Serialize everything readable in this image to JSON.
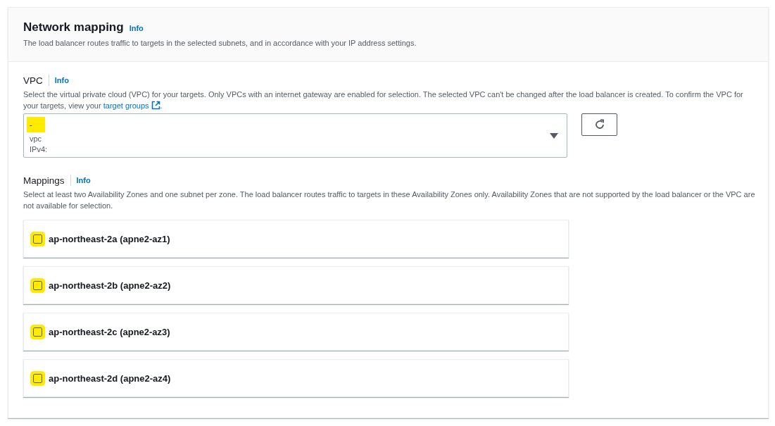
{
  "header": {
    "title": "Network mapping",
    "info": "Info",
    "description": "The load balancer routes traffic to targets in the selected subnets, and in accordance with your IP address settings."
  },
  "vpc": {
    "label": "VPC",
    "info": "Info",
    "description": "Select the virtual private cloud (VPC) for your targets. Only VPCs with an internet gateway are enabled for selection. The selected VPC can't be changed after the load balancer is created. To confirm the VPC for your targets, view your",
    "link": "target groups",
    "after_link": ".",
    "select": {
      "value": "-",
      "lines": [
        "vpc",
        "IPv4:"
      ]
    }
  },
  "mappings": {
    "label": "Mappings",
    "info": "Info",
    "description": "Select at least two Availability Zones and one subnet per zone. The load balancer routes traffic to targets in these Availability Zones only. Availability Zones that are not supported by the load balancer or the VPC are not available for selection.",
    "zones": [
      {
        "label": "ap-northeast-2a (apne2-az1)",
        "checked": false
      },
      {
        "label": "ap-northeast-2b (apne2-az2)",
        "checked": false
      },
      {
        "label": "ap-northeast-2c (apne2-az3)",
        "checked": false
      },
      {
        "label": "ap-northeast-2d (apne2-az4)",
        "checked": false
      }
    ]
  }
}
